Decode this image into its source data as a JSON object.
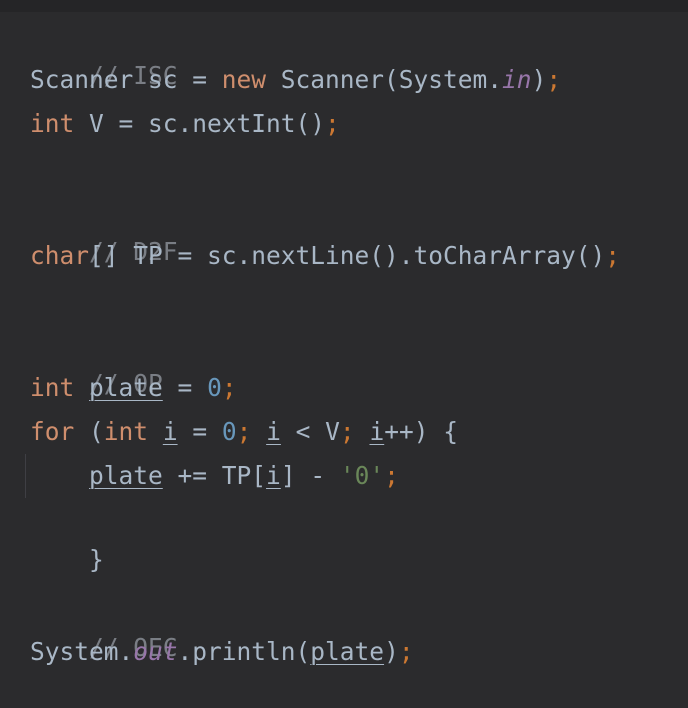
{
  "code": {
    "comment_isc": "// ISC",
    "line_scanner": {
      "t1": "Scanner sc = ",
      "kw_new": "new",
      "t2": " Scanner(System.",
      "field_in": "in",
      "t3": ")",
      "semi": ";"
    },
    "line_int_v": {
      "kw_int": "int",
      "t1": " V = sc.nextInt()",
      "semi": ";"
    },
    "comment_d2f": "// D2F",
    "line_char": {
      "kw_char": "char",
      "t1": "[] TP = sc.nextLine().toCharArray()",
      "semi": ";"
    },
    "comment_op": "// OP",
    "line_int_plate": {
      "kw_int": "int",
      "t1": " ",
      "var_plate": "plate",
      "t2": " = ",
      "num_zero": "0",
      "semi": ";"
    },
    "line_for": {
      "kw_for": "for",
      "t1": " (",
      "kw_int": "int",
      "t2": " ",
      "var_i1": "i",
      "t3": " = ",
      "num_zero": "0",
      "semi1": ";",
      "t4": " ",
      "var_i2": "i",
      "t5": " < V",
      "semi2": ";",
      "t6": " ",
      "var_i3": "i",
      "t7": "++) {"
    },
    "line_body": {
      "indent": "    ",
      "var_plate": "plate",
      "t1": " += TP[",
      "var_i": "i",
      "t2": "] - ",
      "str_zero": "'0'",
      "semi": ";"
    },
    "close_brace": "}",
    "comment_oec": "// OEC",
    "line_print": {
      "t1": "System.",
      "field_out": "out",
      "t2": ".println(",
      "var_plate": "plate",
      "t3": ")",
      "semi": ";"
    }
  }
}
